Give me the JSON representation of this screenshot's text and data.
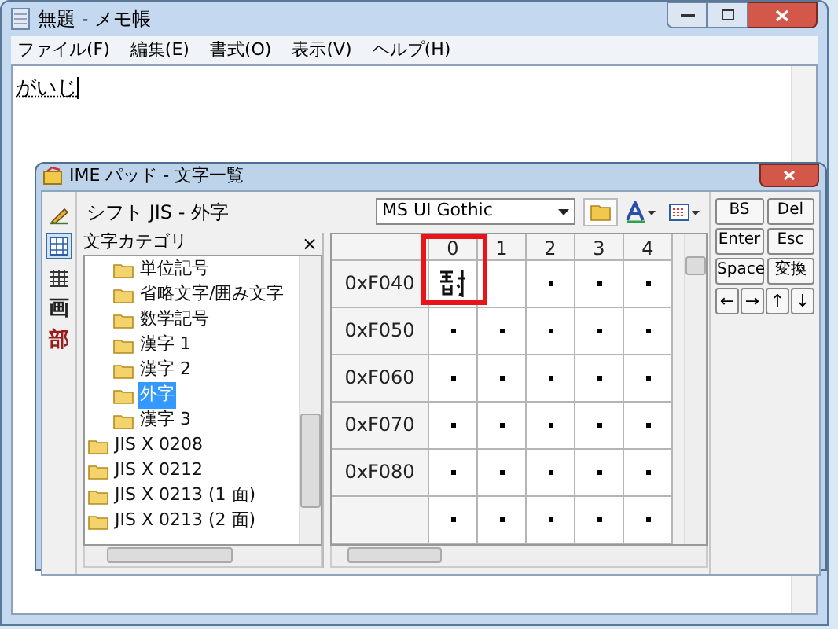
{
  "notepad": {
    "title": "無題 - メモ帳",
    "menu": [
      "ファイル(F)",
      "編集(E)",
      "書式(O)",
      "表示(V)",
      "ヘルプ(H)"
    ],
    "text": "がいじ",
    "composing": true
  },
  "ime_pad": {
    "title": "IME パッド - 文字一覧",
    "tools": [
      {
        "kind": "pen",
        "selected": false
      },
      {
        "kind": "list",
        "selected": true
      },
      {
        "kind": "keyboard",
        "selected": false
      },
      {
        "kind": "char",
        "label": "画",
        "selected": false
      },
      {
        "kind": "char",
        "label": "部",
        "selected": false
      }
    ],
    "charset": "シフト JIS - 外字",
    "categories": {
      "title": "文字カテゴリ",
      "close": "×",
      "items": [
        {
          "children": [
            {
              "label": "単位記号",
              "selected": false
            },
            {
              "label": "省略文字/囲み文字",
              "selected": false
            },
            {
              "label": "数学記号",
              "selected": false
            },
            {
              "label": "漢字 1",
              "selected": false
            },
            {
              "label": "漢字 2",
              "selected": false
            },
            {
              "label": "外字",
              "selected": true
            },
            {
              "label": "漢字 3",
              "selected": false
            }
          ]
        },
        {
          "label": "JIS X 0208",
          "selected": false
        },
        {
          "label": "JIS X 0212",
          "selected": false
        },
        {
          "label": "JIS X 0213 (1 面)",
          "selected": false
        },
        {
          "label": "JIS X 0213 (2 面)",
          "selected": false
        }
      ]
    },
    "font": "MS UI Gothic",
    "grid": {
      "columns": [
        "0",
        "1",
        "2",
        "3",
        "4"
      ],
      "rows": [
        {
          "label": "0xF040",
          "cells": [
            {
              "kind": "glyph",
              "highlighted": true
            },
            {
              "kind": "empty",
              "highlighted": false
            },
            {
              "kind": "dot",
              "highlighted": false
            },
            {
              "kind": "dot",
              "highlighted": false
            },
            {
              "kind": "dot",
              "highlighted": false
            }
          ]
        },
        {
          "label": "0xF050",
          "cells": [
            {
              "kind": "dot",
              "highlighted": false
            },
            {
              "kind": "dot",
              "highlighted": false
            },
            {
              "kind": "dot",
              "highlighted": false
            },
            {
              "kind": "dot",
              "highlighted": false
            },
            {
              "kind": "dot",
              "highlighted": false
            }
          ]
        },
        {
          "label": "0xF060",
          "cells": [
            {
              "kind": "dot",
              "highlighted": false
            },
            {
              "kind": "dot",
              "highlighted": false
            },
            {
              "kind": "dot",
              "highlighted": false
            },
            {
              "kind": "dot",
              "highlighted": false
            },
            {
              "kind": "dot",
              "highlighted": false
            }
          ]
        },
        {
          "label": "0xF070",
          "cells": [
            {
              "kind": "dot",
              "highlighted": false
            },
            {
              "kind": "dot",
              "highlighted": false
            },
            {
              "kind": "dot",
              "highlighted": false
            },
            {
              "kind": "dot",
              "highlighted": false
            },
            {
              "kind": "dot",
              "highlighted": false
            }
          ]
        },
        {
          "label": "0xF080",
          "cells": [
            {
              "kind": "dot",
              "highlighted": false
            },
            {
              "kind": "dot",
              "highlighted": false
            },
            {
              "kind": "dot",
              "highlighted": false
            },
            {
              "kind": "dot",
              "highlighted": false
            },
            {
              "kind": "dot",
              "highlighted": false
            }
          ]
        },
        {
          "cells": [
            {
              "kind": "dot",
              "highlighted": false
            },
            {
              "kind": "dot",
              "highlighted": false
            },
            {
              "kind": "dot",
              "highlighted": false
            },
            {
              "kind": "dot",
              "highlighted": false
            },
            {
              "kind": "dot",
              "highlighted": false
            }
          ]
        }
      ]
    },
    "keys": [
      "BS",
      "Del",
      "Enter",
      "Esc",
      "Space",
      "変換",
      "←",
      "→",
      "↑",
      "↓"
    ]
  }
}
